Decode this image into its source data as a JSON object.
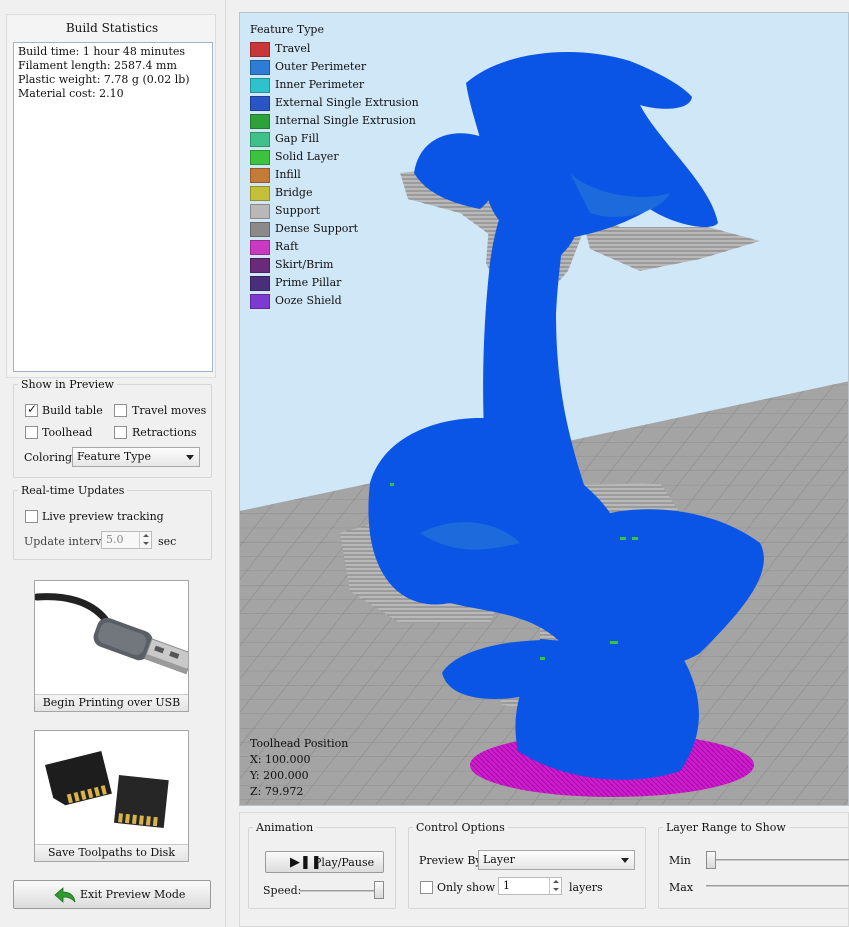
{
  "build_statistics": {
    "title": "Build Statistics",
    "lines": [
      "Build time: 1 hour 48 minutes",
      "Filament length: 2587.4 mm",
      "Plastic weight: 7.78 g (0.02 lb)",
      "Material cost: 2.10"
    ]
  },
  "show_in_preview": {
    "title": "Show in Preview",
    "build_table": {
      "label": "Build table",
      "checked": true
    },
    "travel_moves": {
      "label": "Travel moves",
      "checked": false
    },
    "toolhead": {
      "label": "Toolhead",
      "checked": false
    },
    "retractions": {
      "label": "Retractions",
      "checked": false
    },
    "coloring_label": "Coloring",
    "coloring_value": "Feature Type"
  },
  "realtime_updates": {
    "title": "Real-time Updates",
    "live_tracking": {
      "label": "Live preview tracking",
      "checked": false
    },
    "interval_label": "Update interval",
    "interval_value": "5.0",
    "interval_unit": "sec"
  },
  "actions": {
    "usb": "Begin Printing over USB",
    "disk": "Save Toolpaths to Disk",
    "exit": "Exit Preview Mode"
  },
  "legend": {
    "title": "Feature Type",
    "items": [
      {
        "label": "Travel",
        "color": "#c83838"
      },
      {
        "label": "Outer Perimeter",
        "color": "#2e7cd4"
      },
      {
        "label": "Inner Perimeter",
        "color": "#2ec2cc"
      },
      {
        "label": "External Single Extrusion",
        "color": "#2a55c6"
      },
      {
        "label": "Internal Single Extrusion",
        "color": "#2ea23a"
      },
      {
        "label": "Gap Fill",
        "color": "#3ec28a"
      },
      {
        "label": "Solid Layer",
        "color": "#3cc23c"
      },
      {
        "label": "Infill",
        "color": "#c47a38"
      },
      {
        "label": "Bridge",
        "color": "#c4c03a"
      },
      {
        "label": "Support",
        "color": "#b8b8b8"
      },
      {
        "label": "Dense Support",
        "color": "#8a8a8a"
      },
      {
        "label": "Raft",
        "color": "#c83ac0"
      },
      {
        "label": "Skirt/Brim",
        "color": "#6a2a7a"
      },
      {
        "label": "Prime Pillar",
        "color": "#4a2e7a"
      },
      {
        "label": "Ooze Shield",
        "color": "#7c3ad0"
      }
    ]
  },
  "toolhead_position": {
    "title": "Toolhead Position",
    "x": "X: 100.000",
    "y": "Y: 200.000",
    "z": "Z: 79.972"
  },
  "animation": {
    "title": "Animation",
    "play_label": "Play/Pause",
    "speed_label": "Speed:",
    "speed_level": 1.0
  },
  "control_options": {
    "title": "Control Options",
    "preview_by_label": "Preview By",
    "preview_by_value": "Layer",
    "only_show": {
      "label": "Only show",
      "checked": false
    },
    "only_show_value": "1",
    "layers_label": "layers"
  },
  "layer_range": {
    "title": "Layer Range to Show",
    "min_label": "Min",
    "max_label": "Max"
  },
  "colors": {
    "model_blue": "#0a55e6",
    "support_gray": "#b4b4b4",
    "raft_magenta": "#d21ad2",
    "sky": "#cfe7f7",
    "bed": "#a2a2a2"
  }
}
